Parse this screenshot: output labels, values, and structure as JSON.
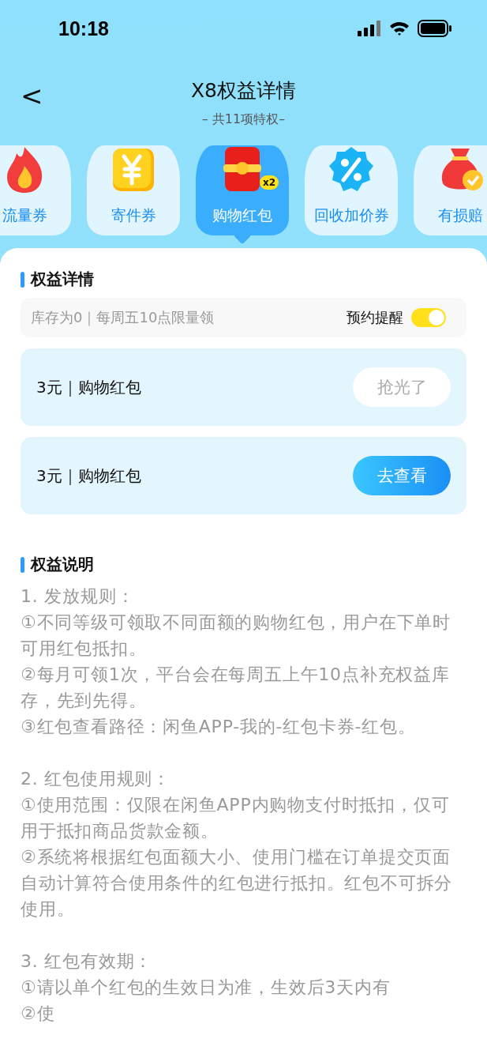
{
  "status_bar": {
    "time": "10:18"
  },
  "header": {
    "back": "<",
    "title": "X8权益详情",
    "subtitle": "– 共11项特权–"
  },
  "tabs": [
    {
      "label": "流量券",
      "selected": false
    },
    {
      "label": "寄件券",
      "selected": false
    },
    {
      "label": "购物红包",
      "selected": true,
      "badge": "x2"
    },
    {
      "label": "回收加价券",
      "selected": false
    },
    {
      "label": "有损赔",
      "selected": false
    }
  ],
  "details": {
    "heading": "权益详情",
    "stock": "库存为0｜每周五10点限量领",
    "reminder": {
      "label": "预约提醒",
      "on": true
    },
    "coupons": [
      {
        "title": "3元｜购物红包",
        "button": {
          "label": "抢光了",
          "disabled": true
        }
      },
      {
        "title": "3元｜购物红包",
        "button": {
          "label": "去查看",
          "disabled": false
        }
      }
    ]
  },
  "rules": {
    "heading": "权益说明",
    "sections": [
      {
        "title": "1. 发放规则：",
        "items": [
          "①不同等级可领取不同面额的购物红包，用户在下单时可用红包抵扣。",
          "②每月可领1次，平台会在每周五上午10点补充权益库存，先到先得。",
          "③红包查看路径：闲鱼APP-我的-红包卡券-红包。"
        ]
      },
      {
        "title": "2. 红包使用规则：",
        "items": [
          "①使用范围：仅限在闲鱼APP内购物支付时抵扣，仅可用于抵扣商品货款金额。",
          "②系统将根据红包面额大小、使用门槛在订单提交页面自动计算符合使用条件的红包进行抵扣。红包不可拆分使用。"
        ]
      },
      {
        "title": "3. 红包有效期：",
        "items": [
          "①请以单个红包的生效日为准，生效后3天内有",
          "②使"
        ]
      }
    ]
  }
}
